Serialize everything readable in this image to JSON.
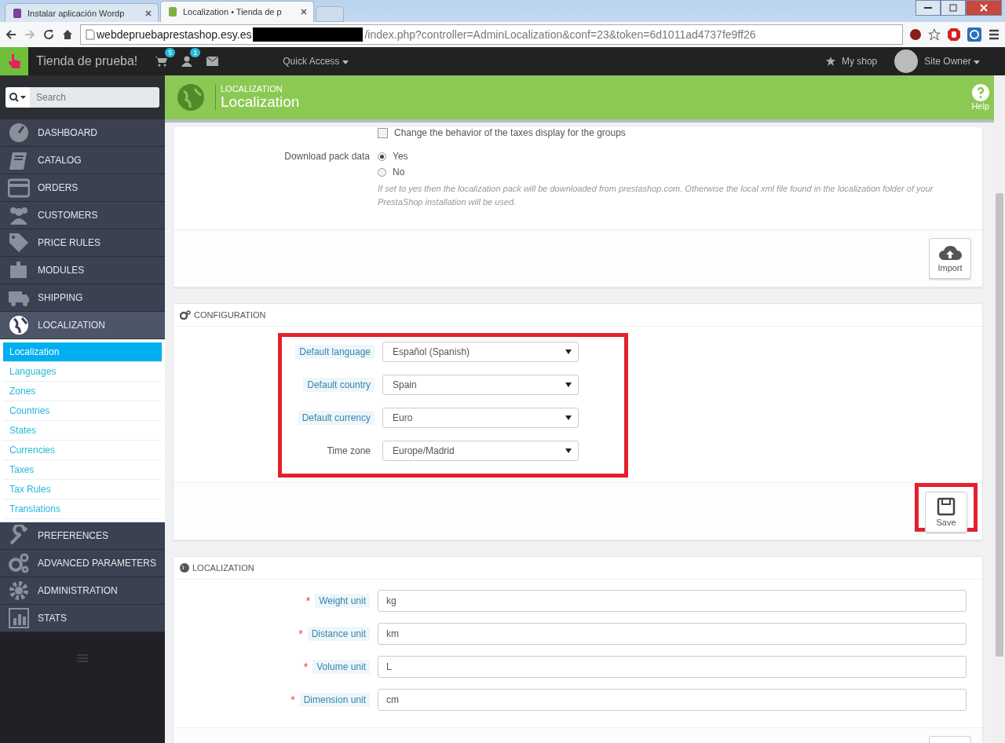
{
  "browser": {
    "tabs": [
      {
        "title": "Instalar aplicación Wordp",
        "selected": false
      },
      {
        "title": "Localization • Tienda de p",
        "selected": true
      }
    ],
    "url_host": "webdepruebaprestashop.esy.es",
    "url_path": "/index.php?controller=AdminLocalization&conf=23&token=6d1011ad4737fe9ff26"
  },
  "admin_header": {
    "shop_name": "Tienda de prueba!",
    "cart_badge": "5",
    "customers_badge": "1",
    "quick_access": "Quick Access",
    "my_shop": "My shop",
    "user": "Site Owner"
  },
  "sidebar": {
    "search_placeholder": "Search",
    "menu": [
      {
        "label": "DASHBOARD",
        "selected": false
      },
      {
        "label": "CATALOG",
        "selected": false
      },
      {
        "label": "ORDERS",
        "selected": false
      },
      {
        "label": "CUSTOMERS",
        "selected": false
      },
      {
        "label": "PRICE RULES",
        "selected": false
      },
      {
        "label": "MODULES",
        "selected": false
      },
      {
        "label": "SHIPPING",
        "selected": false
      },
      {
        "label": "LOCALIZATION",
        "selected": true,
        "children": [
          {
            "label": "Localization",
            "selected": true
          },
          {
            "label": "Languages",
            "selected": false
          },
          {
            "label": "Zones",
            "selected": false
          },
          {
            "label": "Countries",
            "selected": false
          },
          {
            "label": "States",
            "selected": false
          },
          {
            "label": "Currencies",
            "selected": false
          },
          {
            "label": "Taxes",
            "selected": false
          },
          {
            "label": "Tax Rules",
            "selected": false
          },
          {
            "label": "Translations",
            "selected": false
          }
        ]
      },
      {
        "label": "PREFERENCES",
        "selected": false
      },
      {
        "label": "ADVANCED PARAMETERS",
        "selected": false
      },
      {
        "label": "ADMINISTRATION",
        "selected": false
      },
      {
        "label": "STATS",
        "selected": false
      }
    ]
  },
  "page_header": {
    "breadcrumb": "LOCALIZATION",
    "title": "Localization",
    "help": "Help"
  },
  "import_panel": {
    "checkbox": {
      "label": "Change the behavior of the taxes display for the groups",
      "checked": false
    },
    "download_label": "Download pack data",
    "options": [
      {
        "label": "Yes",
        "selected": true
      },
      {
        "label": "No",
        "selected": false
      }
    ],
    "help_text": "If set to yes then the localization pack will be downloaded from prestashop.com. Otherwise the local xml file found in the localization folder of your PrestaShop installation will be used.",
    "button": "Import"
  },
  "configuration": {
    "title": "CONFIGURATION",
    "fields": [
      {
        "label": "Default language",
        "value": "Español (Spanish)",
        "hint": true
      },
      {
        "label": "Default country",
        "value": "Spain",
        "hint": true
      },
      {
        "label": "Default currency",
        "value": "Euro",
        "hint": true
      },
      {
        "label": "Time zone",
        "value": "Europe/Madrid",
        "hint": false
      }
    ],
    "button": "Save"
  },
  "localization": {
    "title": "LOCALIZATION",
    "required_symbol": "*",
    "fields": [
      {
        "label": "Weight unit",
        "value": "kg",
        "required": true
      },
      {
        "label": "Distance unit",
        "value": "km",
        "required": true
      },
      {
        "label": "Volume unit",
        "value": "L",
        "required": true
      },
      {
        "label": "Dimension unit",
        "value": "cm",
        "required": true
      }
    ]
  }
}
